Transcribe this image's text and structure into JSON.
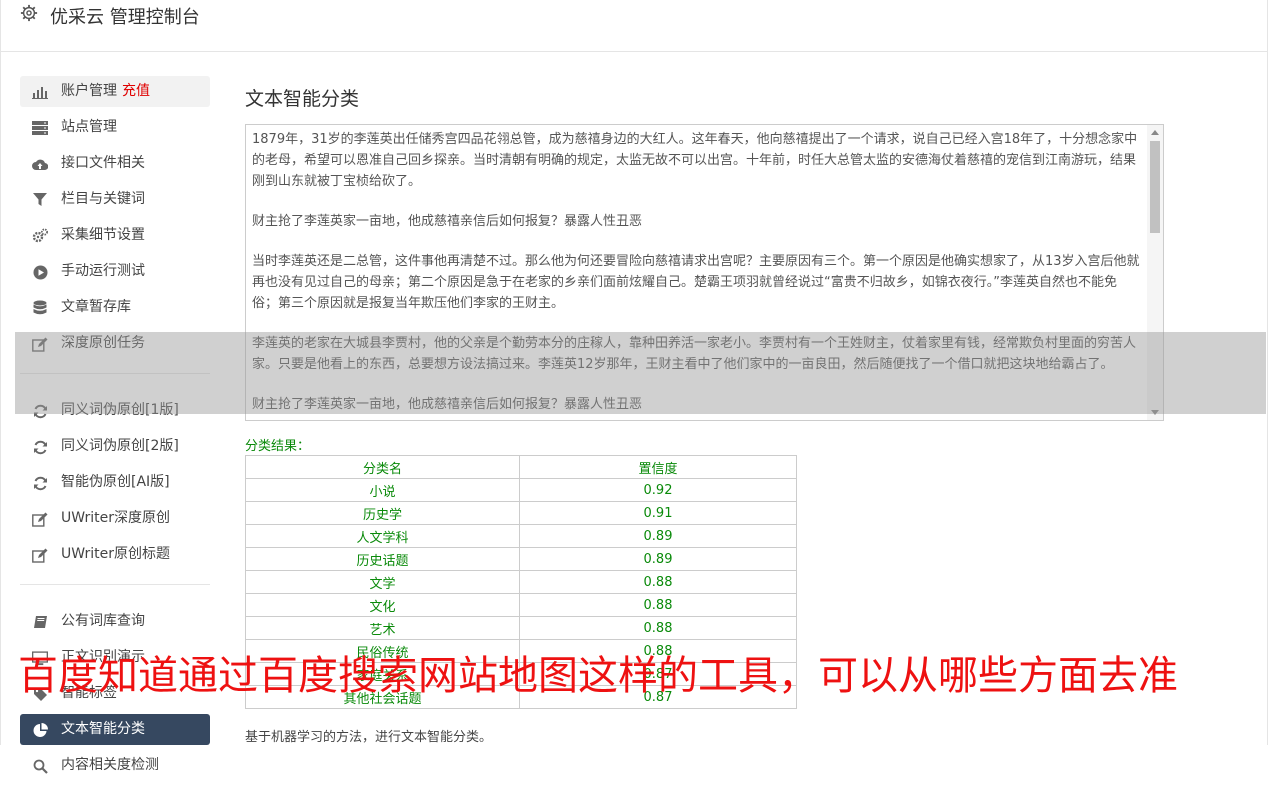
{
  "header": {
    "title": "优采云 管理控制台",
    "icon": "gear-icon"
  },
  "sidebar": {
    "group1": [
      {
        "icon": "bar-chart-icon",
        "label": "账户管理",
        "badge": "充值"
      },
      {
        "icon": "server-icon",
        "label": "站点管理"
      },
      {
        "icon": "cloud-upload-icon",
        "label": "接口文件相关"
      },
      {
        "icon": "filter-icon",
        "label": "栏目与关键词"
      },
      {
        "icon": "cogs-icon",
        "label": "采集细节设置"
      },
      {
        "icon": "play-circle-icon",
        "label": "手动运行测试"
      },
      {
        "icon": "database-icon",
        "label": "文章暂存库"
      },
      {
        "icon": "edit-icon",
        "label": "深度原创任务"
      }
    ],
    "group2": [
      {
        "icon": "refresh-icon",
        "label": "同义词伪原创[1版]"
      },
      {
        "icon": "refresh-icon",
        "label": "同义词伪原创[2版]"
      },
      {
        "icon": "refresh-icon",
        "label": "智能伪原创[AI版]"
      },
      {
        "icon": "edit-icon",
        "label": "UWriter深度原创"
      },
      {
        "icon": "edit-icon",
        "label": "UWriter原创标题"
      }
    ],
    "group3": [
      {
        "icon": "book-icon",
        "label": "公有词库查询"
      },
      {
        "icon": "monitor-icon",
        "label": "正文识别演示"
      },
      {
        "icon": "tag-icon",
        "label": "智能标签"
      },
      {
        "icon": "pie-chart-icon",
        "label": "文本智能分类",
        "active": true
      },
      {
        "icon": "search-icon",
        "label": "内容相关度检测"
      }
    ]
  },
  "main": {
    "title": "文本智能分类",
    "text_paragraphs": [
      "1879年，31岁的李莲英出任储秀宫四品花翎总管，成为慈禧身边的大红人。这年春天，他向慈禧提出了一个请求，说自己已经入宫18年了，十分想念家中的老母，希望可以恩准自己回乡探亲。当时清朝有明确的规定，太监无故不可以出宫。十年前，时任大总管太监的安德海仗着慈禧的宠信到江南游玩，结果刚到山东就被丁宝桢给砍了。",
      "财主抢了李莲英家一亩地，他成慈禧亲信后如何报复？暴露人性丑恶",
      "当时李莲英还是二总管，这件事他再清楚不过。那么他为何还要冒险向慈禧请求出宫呢？主要原因有三个。第一个原因是他确实想家了，从13岁入宫后他就再也没有见过自己的母亲；第二个原因是急于在老家的乡亲们面前炫耀自己。楚霸王项羽就曾经说过“富贵不归故乡，如锦衣夜行。”李莲英自然也不能免俗；第三个原因就是报复当年欺压他们李家的王财主。",
      "李莲英的老家在大城县李贾村，他的父亲是个勤劳本分的庄稼人，靠种田养活一家老小。李贾村有一个王姓财主，仗着家里有钱，经常欺负村里面的穷苦人家。只要是他看上的东西，总要想方设法搞过来。李莲英12岁那年，王财主看中了他们家中的一亩良田，然后随便找了一个借口就把这块地给霸占了。",
      "财主抢了李莲英家一亩地，他成慈禧亲信后如何报复？暴露人性丑恶"
    ],
    "result_label": "分类结果：",
    "table": {
      "headers": [
        "分类名",
        "置信度"
      ],
      "rows": [
        [
          "小说",
          "0.92"
        ],
        [
          "历史学",
          "0.91"
        ],
        [
          "人文学科",
          "0.89"
        ],
        [
          "历史话题",
          "0.89"
        ],
        [
          "文学",
          "0.88"
        ],
        [
          "文化",
          "0.88"
        ],
        [
          "艺术",
          "0.88"
        ],
        [
          "民俗传统",
          "0.88"
        ],
        [
          "家庭关系",
          "0.87"
        ],
        [
          "其他社会话题",
          "0.87"
        ]
      ]
    },
    "footer_note": "基于机器学习的方法，进行文本智能分类。"
  },
  "overlay": {
    "banner_text": "百度知道通过百度搜索网站地图这样的工具，可以从哪些方面去准"
  },
  "colors": {
    "active_nav_bg": "#364860",
    "result_green": "#0a8a0a",
    "recharge_red": "#e00000",
    "banner_red": "#ee1111"
  }
}
